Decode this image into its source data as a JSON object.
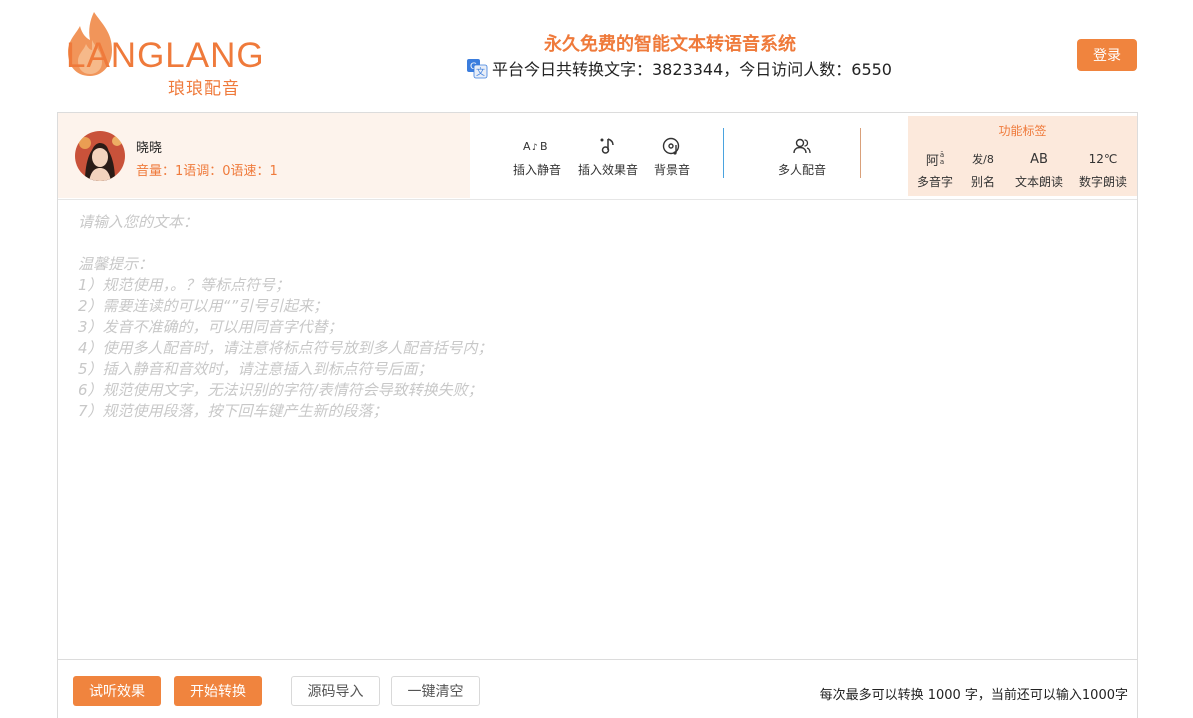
{
  "brand": {
    "logo_text": "LANGLANG",
    "logo_subtitle": "琅琅配音",
    "brand_color": "#ef7a3b"
  },
  "header": {
    "title": "永久免费的智能文本转语音系统",
    "stats": "平台今日共转换文字：3823344，今日访问人数：6550",
    "stats_icon": "translate-icon",
    "login_label": "登录"
  },
  "voice": {
    "name": "晓晓",
    "params": "音量：1语调：0语速：1",
    "avatar": "avatar-portrait"
  },
  "toolbar": {
    "tools": [
      {
        "icon_text": "A♪B",
        "label": "插入静音"
      },
      {
        "icon_text": "♪",
        "label": "插入效果音"
      },
      {
        "icon_text": "◎",
        "label": "背景音"
      },
      {
        "icon_text": "",
        "label": "多人配音"
      }
    ]
  },
  "tags": {
    "title": "功能标签",
    "items": [
      {
        "icon_text": "阿",
        "label": "多音字"
      },
      {
        "icon_text": "发",
        "label": "别名"
      },
      {
        "icon_text": "AB",
        "label": "文本朗读"
      },
      {
        "icon_text": "12℃",
        "label": "数字朗读"
      }
    ]
  },
  "editor": {
    "placeholder": "请输入您的文本：\n\n温馨提示：\n1）规范使用，。？等标点符号；\n2）需要连读的可以用“”引号引起来；\n3）发音不准确的，可以用同音字代替；\n4）使用多人配音时，请注意将标点符号放到多人配音括号内；\n5）插入静音和音效时，请注意插入到标点符号后面；\n6）规范使用文字，无法识别的字符/表情符会导致转换失败；\n7）规范使用段落，按下回车键产生新的段落；",
    "value": ""
  },
  "footer": {
    "try_label": "试听效果",
    "convert_label": "开始转换",
    "import_label": "源码导入",
    "clear_label": "一键清空",
    "note": "每次最多可以转换 1000 字，当前还可以输入1000字"
  }
}
